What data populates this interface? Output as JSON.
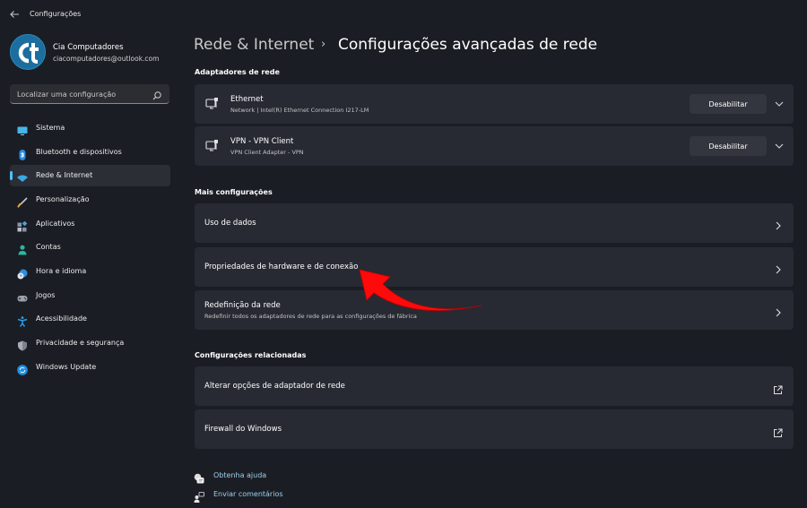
{
  "window": {
    "title": "Configurações",
    "back_icon": "back-arrow-icon"
  },
  "user": {
    "avatar_initials": "ct",
    "name": "Cia Computadores",
    "email": "ciacomputadores@outlook.com"
  },
  "search": {
    "placeholder": "Localizar uma configuração",
    "value": "",
    "icon": "search-icon"
  },
  "sidebar": {
    "items": [
      {
        "label": "Sistema",
        "icon": "monitor-icon",
        "active": false
      },
      {
        "label": "Bluetooth e dispositivos",
        "icon": "bluetooth-icon",
        "active": false
      },
      {
        "label": "Rede & Internet",
        "icon": "wifi-icon",
        "active": true
      },
      {
        "label": "Personalização",
        "icon": "brush-icon",
        "active": false
      },
      {
        "label": "Aplicativos",
        "icon": "apps-icon",
        "active": false
      },
      {
        "label": "Contas",
        "icon": "person-icon",
        "active": false
      },
      {
        "label": "Hora e idioma",
        "icon": "clock-globe-icon",
        "active": false
      },
      {
        "label": "Jogos",
        "icon": "gamepad-icon",
        "active": false
      },
      {
        "label": "Acessibilidade",
        "icon": "accessibility-icon",
        "active": false
      },
      {
        "label": "Privacidade e segurança",
        "icon": "shield-icon",
        "active": false
      },
      {
        "label": "Windows Update",
        "icon": "update-icon",
        "active": false
      }
    ]
  },
  "header": {
    "breadcrumb_parent": "Rede & Internet",
    "separator": "›",
    "title": "Configurações avançadas de rede"
  },
  "adapters": {
    "section_title": "Adaptadores de rede",
    "items": [
      {
        "name": "Ethernet",
        "description": "Network | Intel(R) Ethernet Connection I217-LM",
        "button_label": "Desabilitar",
        "icon": "network-adapter-icon"
      },
      {
        "name": "VPN - VPN Client",
        "description": "VPN Client Adapter - VPN",
        "button_label": "Desabilitar",
        "icon": "network-adapter-icon"
      }
    ]
  },
  "more_settings": {
    "section_title": "Mais configurações",
    "items": [
      {
        "title": "Uso de dados",
        "subtitle": ""
      },
      {
        "title": "Propriedades de hardware e de conexão",
        "subtitle": ""
      },
      {
        "title": "Redefinição da rede",
        "subtitle": "Redefinir todos os adaptadores de rede para as configurações de fábrica"
      }
    ]
  },
  "related_settings": {
    "section_title": "Configurações relacionadas",
    "items": [
      {
        "title": "Alterar opções de adaptador de rede",
        "icon": "open-external-icon"
      },
      {
        "title": "Firewall do Windows",
        "icon": "open-external-icon"
      }
    ]
  },
  "footer": {
    "help_label": "Obtenha ajuda",
    "feedback_label": "Enviar comentários"
  },
  "annotation": {
    "arrow_color": "#ff0000",
    "points_to": "Propriedades de hardware e de conexão"
  },
  "colors": {
    "accent": "#4cc2ff",
    "background": "#1b1d24",
    "card": "#272a33",
    "link": "#9fd0ec"
  }
}
